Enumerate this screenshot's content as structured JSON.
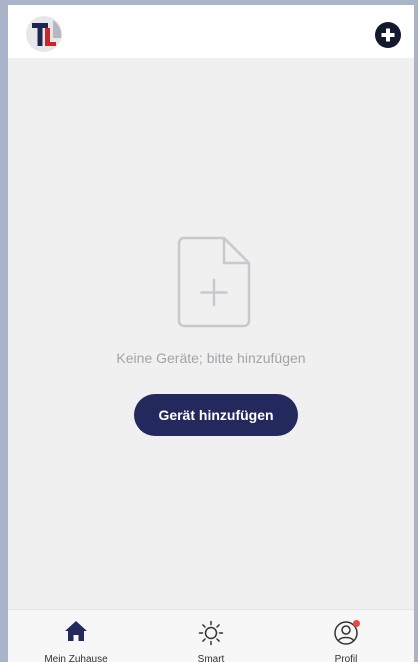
{
  "header": {
    "logo": {
      "text": "TL",
      "icon": "tl-logo-icon"
    },
    "add_icon": "plus-circle-icon"
  },
  "empty_state": {
    "icon": "add-document-icon",
    "message": "Keine Geräte; bitte hinzufügen",
    "button_label": "Gerät hinzufügen"
  },
  "tabs": [
    {
      "label": "Mein Zuhause",
      "icon": "home-icon",
      "active": true
    },
    {
      "label": "Smart",
      "icon": "sun-icon",
      "active": false
    },
    {
      "label": "Profil",
      "icon": "profile-icon",
      "badge": true,
      "active": false
    }
  ],
  "colors": {
    "accent": "#24295d",
    "badge": "#e84a3c",
    "logo_red": "#c62828",
    "background": "#f0f0f1"
  }
}
